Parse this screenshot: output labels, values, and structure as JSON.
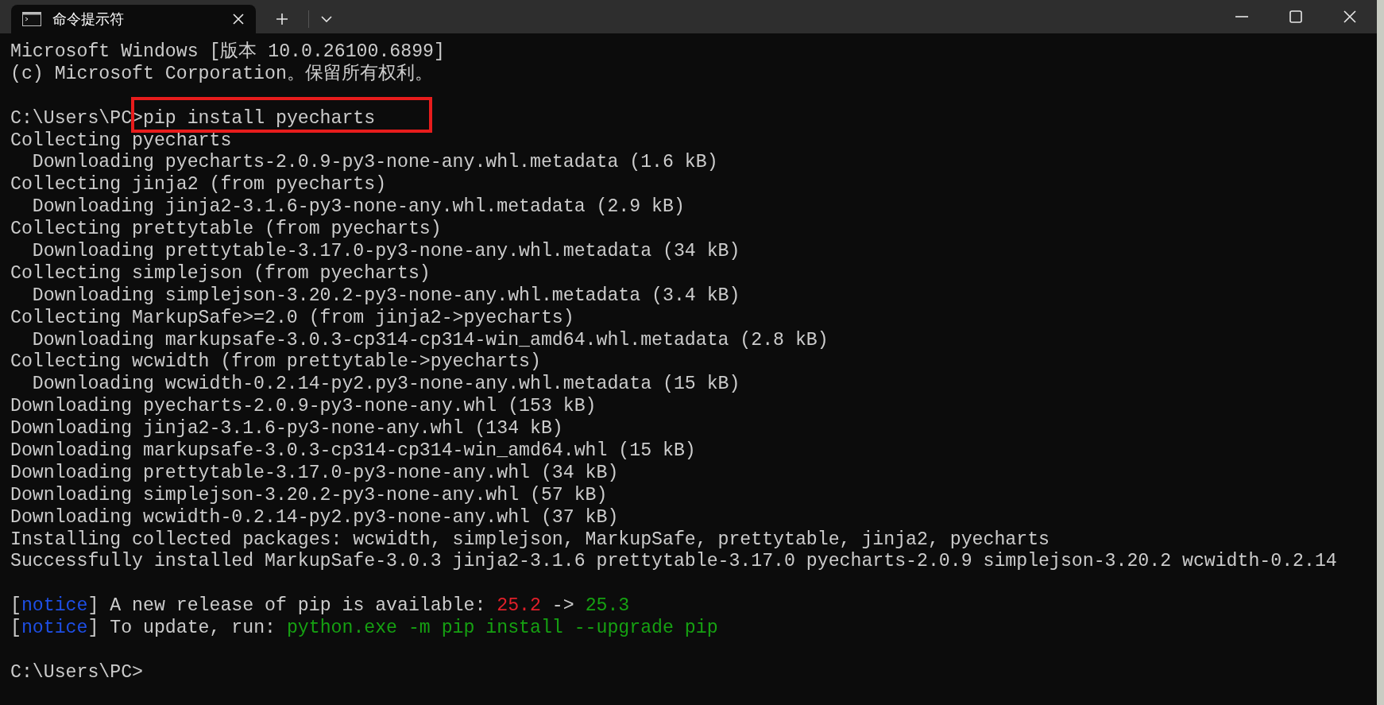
{
  "tabs": [
    {
      "title": "命令提示符",
      "selected": true
    }
  ],
  "lines": [
    {
      "kind": "output",
      "segments": [
        {
          "text": "Microsoft Windows [版本 10.0.26100.6899]"
        }
      ]
    },
    {
      "kind": "output",
      "segments": [
        {
          "text": "(c) Microsoft Corporation。保留所有权利。"
        }
      ]
    },
    {
      "kind": "blank"
    },
    {
      "kind": "prompt",
      "prompt": "C:\\Users\\PC>",
      "command": "pip install pyecharts",
      "highlighted": true
    },
    {
      "kind": "output",
      "segments": [
        {
          "text": "Collecting pyecharts"
        }
      ]
    },
    {
      "kind": "output",
      "segments": [
        {
          "text": "  Downloading pyecharts-2.0.9-py3-none-any.whl.metadata (1.6 kB)"
        }
      ]
    },
    {
      "kind": "output",
      "segments": [
        {
          "text": "Collecting jinja2 (from pyecharts)"
        }
      ]
    },
    {
      "kind": "output",
      "segments": [
        {
          "text": "  Downloading jinja2-3.1.6-py3-none-any.whl.metadata (2.9 kB)"
        }
      ]
    },
    {
      "kind": "output",
      "segments": [
        {
          "text": "Collecting prettytable (from pyecharts)"
        }
      ]
    },
    {
      "kind": "output",
      "segments": [
        {
          "text": "  Downloading prettytable-3.17.0-py3-none-any.whl.metadata (34 kB)"
        }
      ]
    },
    {
      "kind": "output",
      "segments": [
        {
          "text": "Collecting simplejson (from pyecharts)"
        }
      ]
    },
    {
      "kind": "output",
      "segments": [
        {
          "text": "  Downloading simplejson-3.20.2-py3-none-any.whl.metadata (3.4 kB)"
        }
      ]
    },
    {
      "kind": "output",
      "segments": [
        {
          "text": "Collecting MarkupSafe>=2.0 (from jinja2->pyecharts)"
        }
      ]
    },
    {
      "kind": "output",
      "segments": [
        {
          "text": "  Downloading markupsafe-3.0.3-cp314-cp314-win_amd64.whl.metadata (2.8 kB)"
        }
      ]
    },
    {
      "kind": "output",
      "segments": [
        {
          "text": "Collecting wcwidth (from prettytable->pyecharts)"
        }
      ]
    },
    {
      "kind": "output",
      "segments": [
        {
          "text": "  Downloading wcwidth-0.2.14-py2.py3-none-any.whl.metadata (15 kB)"
        }
      ]
    },
    {
      "kind": "output",
      "segments": [
        {
          "text": "Downloading pyecharts-2.0.9-py3-none-any.whl (153 kB)"
        }
      ]
    },
    {
      "kind": "output",
      "segments": [
        {
          "text": "Downloading jinja2-3.1.6-py3-none-any.whl (134 kB)"
        }
      ]
    },
    {
      "kind": "output",
      "segments": [
        {
          "text": "Downloading markupsafe-3.0.3-cp314-cp314-win_amd64.whl (15 kB)"
        }
      ]
    },
    {
      "kind": "output",
      "segments": [
        {
          "text": "Downloading prettytable-3.17.0-py3-none-any.whl (34 kB)"
        }
      ]
    },
    {
      "kind": "output",
      "segments": [
        {
          "text": "Downloading simplejson-3.20.2-py3-none-any.whl (57 kB)"
        }
      ]
    },
    {
      "kind": "output",
      "segments": [
        {
          "text": "Downloading wcwidth-0.2.14-py2.py3-none-any.whl (37 kB)"
        }
      ]
    },
    {
      "kind": "output",
      "segments": [
        {
          "text": "Installing collected packages: wcwidth, simplejson, MarkupSafe, prettytable, jinja2, pyecharts"
        }
      ]
    },
    {
      "kind": "output",
      "segments": [
        {
          "text": "Successfully installed MarkupSafe-3.0.3 jinja2-3.1.6 prettytable-3.17.0 pyecharts-2.0.9 simplejson-3.20.2 wcwidth-0.2.14"
        }
      ]
    },
    {
      "kind": "blank"
    },
    {
      "kind": "output",
      "segments": [
        {
          "text": "["
        },
        {
          "text": "notice",
          "color": "#1e4fe6"
        },
        {
          "text": "] A new release of pip is available: "
        },
        {
          "text": "25.2",
          "color": "#e0202a"
        },
        {
          "text": " -> "
        },
        {
          "text": "25.3",
          "color": "#16a112"
        }
      ]
    },
    {
      "kind": "output",
      "segments": [
        {
          "text": "["
        },
        {
          "text": "notice",
          "color": "#1e4fe6"
        },
        {
          "text": "] To update, run: "
        },
        {
          "text": "python.exe -m pip install --upgrade pip",
          "color": "#16a112"
        }
      ]
    },
    {
      "kind": "blank"
    },
    {
      "kind": "prompt",
      "prompt": "C:\\Users\\PC>"
    }
  ]
}
